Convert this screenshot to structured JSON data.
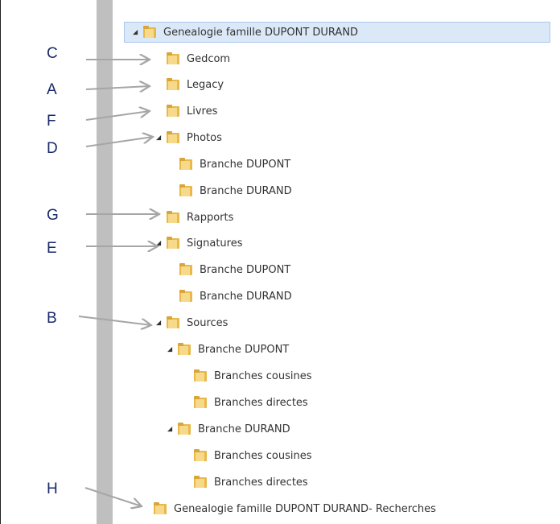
{
  "tree": {
    "root": {
      "label": "Genealogie famille DUPONT DURAND",
      "expanded": true,
      "selected": true
    },
    "items": [
      {
        "label": "Gedcom",
        "expander": "none"
      },
      {
        "label": "Legacy",
        "expander": "none"
      },
      {
        "label": "Livres",
        "expander": "none"
      },
      {
        "label": "Photos",
        "expander": "expanded"
      },
      {
        "label": "Branche DUPONT",
        "expander": "none"
      },
      {
        "label": "Branche DURAND",
        "expander": "none"
      },
      {
        "label": "Rapports",
        "expander": "none"
      },
      {
        "label": "Signatures",
        "expander": "expanded"
      },
      {
        "label": "Branche DUPONT",
        "expander": "none"
      },
      {
        "label": "Branche DURAND",
        "expander": "none"
      },
      {
        "label": "Sources",
        "expander": "expanded"
      },
      {
        "label": "Branche DUPONT",
        "expander": "expanded"
      },
      {
        "label": "Branches cousines",
        "expander": "none"
      },
      {
        "label": "Branches directes",
        "expander": "none"
      },
      {
        "label": "Branche DURAND",
        "expander": "expanded"
      },
      {
        "label": "Branches cousines",
        "expander": "none"
      },
      {
        "label": "Branches directes",
        "expander": "none"
      },
      {
        "label": "Genealogie famille DUPONT DURAND- Recherches",
        "expander": "none"
      }
    ]
  },
  "annotations": [
    {
      "letter": "C",
      "target": "Gedcom"
    },
    {
      "letter": "A",
      "target": "Legacy"
    },
    {
      "letter": "F",
      "target": "Livres"
    },
    {
      "letter": "D",
      "target": "Photos"
    },
    {
      "letter": "G",
      "target": "Rapports"
    },
    {
      "letter": "E",
      "target": "Signatures"
    },
    {
      "letter": "B",
      "target": "Sources"
    },
    {
      "letter": "H",
      "target": "Genealogie famille DUPONT DURAND- Recherches"
    }
  ],
  "colors": {
    "selection": "#dbe8f7",
    "folder": "#e8b94a",
    "letter": "#1a2a6c",
    "arrow": "#a6a6a6",
    "gutter": "#bfbfbf"
  }
}
